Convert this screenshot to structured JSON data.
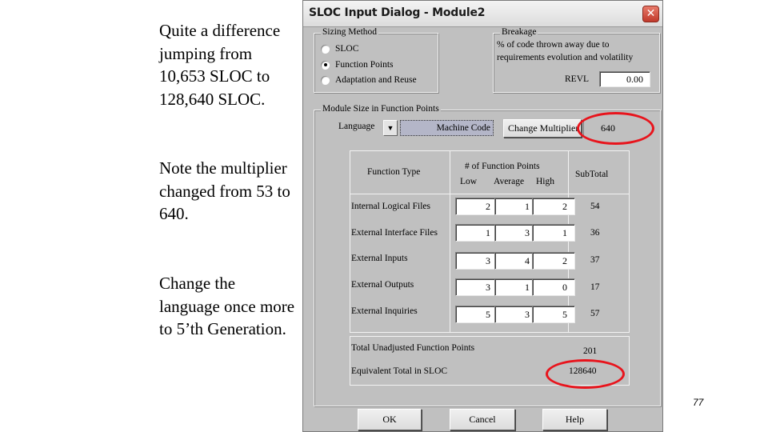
{
  "slide": {
    "notes": [
      "Quite a difference jumping from 10,653 SLOC to 128,640 SLOC.",
      "Note the multiplier changed from 53 to 640.",
      "Change the language once more to 5’th Generation."
    ],
    "page_number": "77"
  },
  "dialog": {
    "title": "SLOC Input Dialog - Module2",
    "close_label": "✕",
    "sizing_method": {
      "legend": "Sizing Method",
      "options": [
        {
          "label": "SLOC",
          "checked": false
        },
        {
          "label": "Function Points",
          "checked": true
        },
        {
          "label": "Adaptation and Reuse",
          "checked": false
        }
      ]
    },
    "breakage": {
      "legend": "Breakage",
      "description_line1": "% of code thrown away due to",
      "description_line2": "requirements evolution and volatility",
      "revl_label": "REVL",
      "revl_value": "0.00"
    },
    "module_size": {
      "legend": "Module Size in Function Points",
      "language_label": "Language",
      "language_value": "Machine Code",
      "change_multiplier_label": "Change Multiplier",
      "multiplier_value": "640",
      "table": {
        "headers": {
          "function_type": "Function Type",
          "num_fp": "# of Function Points",
          "low": "Low",
          "average": "Average",
          "high": "High",
          "subtotal": "SubTotal"
        },
        "rows": [
          {
            "type": "Internal Logical Files",
            "low": "2",
            "average": "1",
            "high": "2",
            "subtotal": "54"
          },
          {
            "type": "External Interface Files",
            "low": "1",
            "average": "3",
            "high": "1",
            "subtotal": "36"
          },
          {
            "type": "External Inputs",
            "low": "3",
            "average": "4",
            "high": "2",
            "subtotal": "37"
          },
          {
            "type": "External Outputs",
            "low": "3",
            "average": "1",
            "high": "0",
            "subtotal": "17"
          },
          {
            "type": "External Inquiries",
            "low": "5",
            "average": "3",
            "high": "5",
            "subtotal": "57"
          }
        ]
      },
      "totals": {
        "unadjusted_label": "Total Unadjusted Function Points",
        "unadjusted_value": "201",
        "sloc_label": "Equivalent Total in SLOC",
        "sloc_value": "128640"
      }
    },
    "buttons": {
      "ok": "OK",
      "cancel": "Cancel",
      "help": "Help"
    },
    "annotation_color": "#e8141c"
  }
}
